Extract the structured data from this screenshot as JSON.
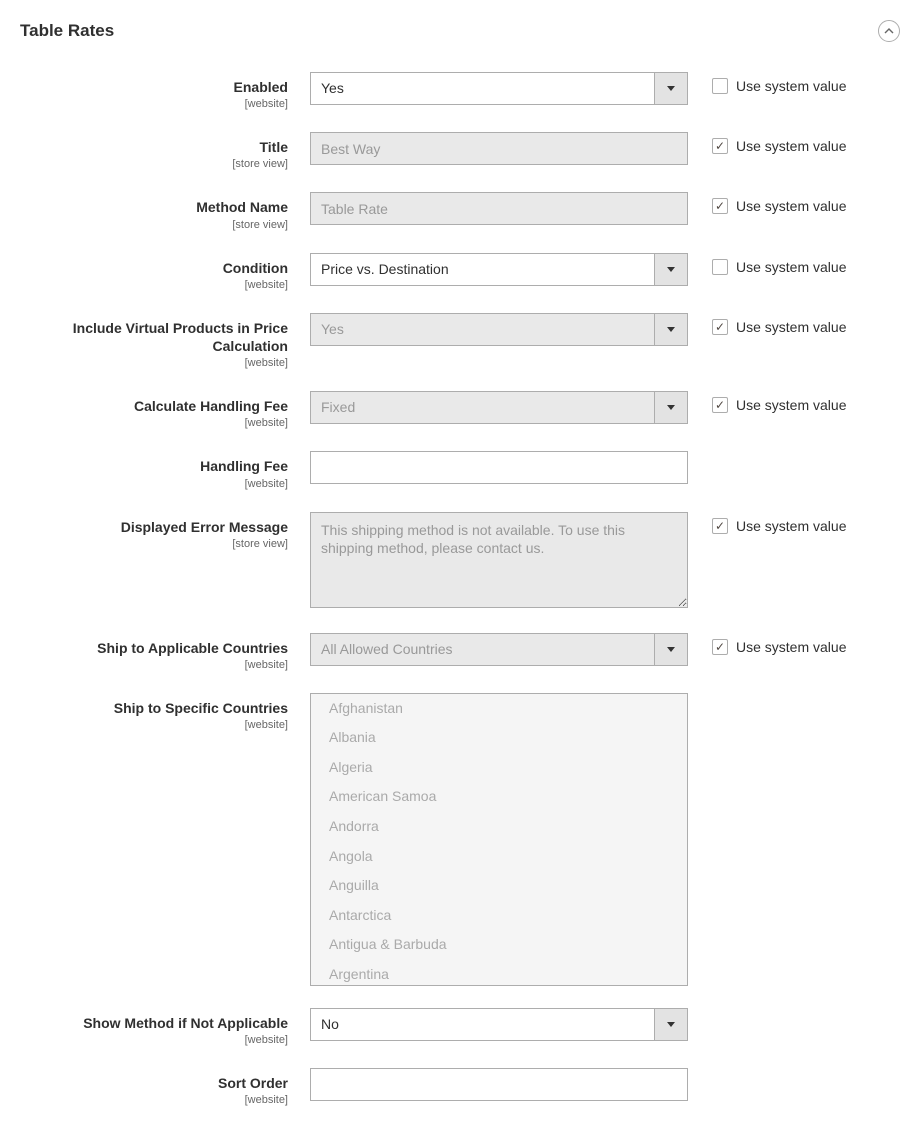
{
  "section": {
    "title": "Table Rates"
  },
  "sys_label": "Use system value",
  "scopes": {
    "website": "[website]",
    "store": "[store view]"
  },
  "fields": {
    "enabled": {
      "label": "Enabled",
      "scope": "website",
      "value": "Yes",
      "sys": false
    },
    "title": {
      "label": "Title",
      "scope": "store",
      "value": "Best Way",
      "sys": true
    },
    "method": {
      "label": "Method Name",
      "scope": "store",
      "value": "Table Rate",
      "sys": true
    },
    "condition": {
      "label": "Condition",
      "scope": "website",
      "value": "Price vs. Destination",
      "sys": false
    },
    "virtual": {
      "label": "Include Virtual Products in Price Calculation",
      "scope": "website",
      "value": "Yes",
      "sys": true
    },
    "calcfee": {
      "label": "Calculate Handling Fee",
      "scope": "website",
      "value": "Fixed",
      "sys": true
    },
    "handfee": {
      "label": "Handling Fee",
      "scope": "website",
      "value": ""
    },
    "errmsg": {
      "label": "Displayed Error Message",
      "scope": "store",
      "value": "This shipping method is not available. To use this shipping method, please contact us.",
      "sys": true
    },
    "shipapp": {
      "label": "Ship to Applicable Countries",
      "scope": "website",
      "value": "All Allowed Countries",
      "sys": true
    },
    "shipspec": {
      "label": "Ship to Specific Countries",
      "scope": "website"
    },
    "showna": {
      "label": "Show Method if Not Applicable",
      "scope": "website",
      "value": "No"
    },
    "sortorder": {
      "label": "Sort Order",
      "scope": "website",
      "value": ""
    }
  },
  "countries": [
    "Afghanistan",
    "Albania",
    "Algeria",
    "American Samoa",
    "Andorra",
    "Angola",
    "Anguilla",
    "Antarctica",
    "Antigua & Barbuda",
    "Argentina"
  ]
}
